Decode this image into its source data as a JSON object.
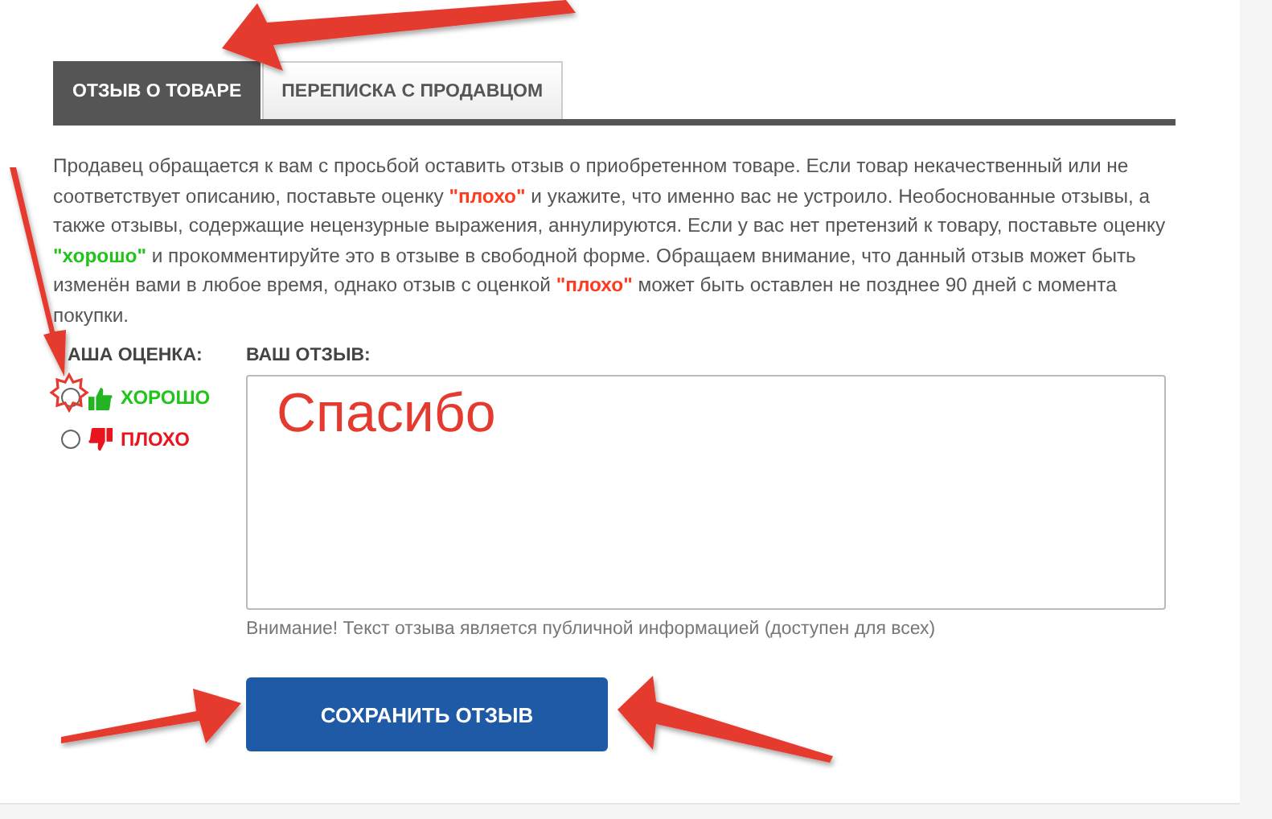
{
  "tabs": [
    {
      "label": "ОТЗЫВ О ТОВАРЕ",
      "selected": true
    },
    {
      "label": "ПЕРЕПИСКА С ПРОДАВЦОМ",
      "selected": false
    }
  ],
  "notice": [
    {
      "kind": "plain",
      "text": "Продавец обращается к вам с просьбой оставить отзыв о приобретенном товаре. Если товар некачественный или не соответствует описанию, поставьте оценку "
    },
    {
      "kind": "bad",
      "text": "\"плохо\""
    },
    {
      "kind": "plain",
      "text": " и укажите, что именно вас не устроило. Необоснованные отзывы, а также отзывы, содержащие нецензурные выражения, аннулируются. Если у вас нет претензий к товару, поставьте оценку "
    },
    {
      "kind": "good",
      "text": "\"хорошо\""
    },
    {
      "kind": "plain",
      "text": " и прокомментируйте это в отзыве в свободной форме. Обращаем внимание, что данный отзыв может быть изменён вами в любое время, однако отзыв с оценкой "
    },
    {
      "kind": "bad",
      "text": "\"плохо\""
    },
    {
      "kind": "plain",
      "text": " может быть оставлен не позднее 90 дней с момента покупки."
    }
  ],
  "rating": {
    "label": "АША ОЦЕНКА:",
    "options": [
      {
        "kind": "good",
        "label": "ХОРОШО",
        "selected": false
      },
      {
        "kind": "bad",
        "label": "ПЛОХО",
        "selected": false
      }
    ]
  },
  "review": {
    "label": "ВАШ ОТЗЫВ:",
    "value": "Спасибо",
    "hint": "Внимание! Текст отзыва является публичной информацией (доступен для всех)"
  },
  "save_button": "СОХРАНИТЬ ОТЗЫВ"
}
